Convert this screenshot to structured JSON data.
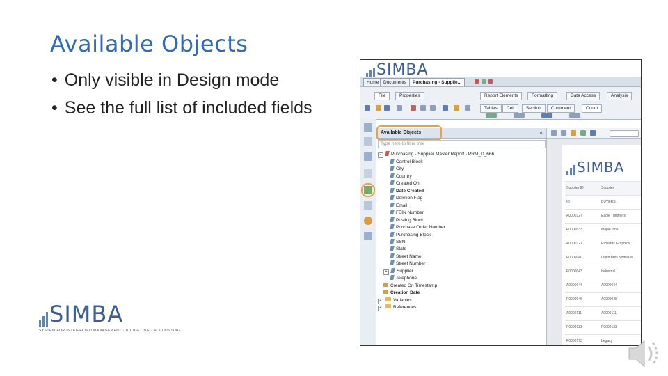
{
  "slide": {
    "title": "Available Objects",
    "bullets": [
      "Only visible in Design mode",
      "See the full list of included fields"
    ]
  },
  "logos": {
    "brand": "SIMBA",
    "tagline": "SYSTEM FOR INTEGRATED MANAGEMENT · BUDGETING · ACCOUNTING"
  },
  "screenshot": {
    "top_tabs": [
      "Home",
      "Documents",
      "Purchasing - Supplie..."
    ],
    "ribbon_tabs_left": [
      "File",
      "Properties"
    ],
    "ribbon_tabs_right": [
      "Report Elements",
      "Formatting",
      "Data Access",
      "Analysis"
    ],
    "ribbon_subtabs": [
      "Tables",
      "Cell",
      "Section",
      "Comment",
      "Count"
    ],
    "panel_title": "Available Objects",
    "filter_placeholder": "Type here to filter tree",
    "tree_root": "Purchasing - Supplier Master Report - PRM_D_666",
    "fields": [
      "Control Block",
      "City",
      "Country",
      "Created On",
      "Date Created",
      "Deletion Flag",
      "Email",
      "FEIN Number",
      "Posting Block",
      "Purchase Order Number",
      "Purchasing Block",
      "SSN",
      "State",
      "Street Name",
      "Street Number",
      "Supplier",
      "Telephone",
      "Created On Timestamp",
      "Creation Date",
      "Variables",
      "References"
    ],
    "report_columns": [
      "Supplier ID",
      "Supplier"
    ],
    "report_header": [
      "ID",
      "BUYERS"
    ],
    "report_rows": [
      [
        "A0000327",
        "Eagle Trimmers"
      ],
      [
        "P0000033",
        "Maple Inns"
      ],
      [
        "A0000327",
        "Richards Graphics"
      ],
      [
        "P0000040",
        "Lupin Bros Software"
      ],
      [
        "P0000043",
        "Industrial"
      ],
      [
        "A0000044",
        "A0000044"
      ],
      [
        "P0000046",
        "A0000046"
      ],
      [
        "A0000111",
        "A0000111"
      ],
      [
        "P0000133",
        "P0000133"
      ],
      [
        "P0000173",
        "Legacy"
      ],
      [
        "P0000200",
        "P0000200"
      ]
    ]
  },
  "colors": {
    "title": "#2E6CB5",
    "highlight_ring": "#E8A33C",
    "brand": "#3a5f95"
  }
}
